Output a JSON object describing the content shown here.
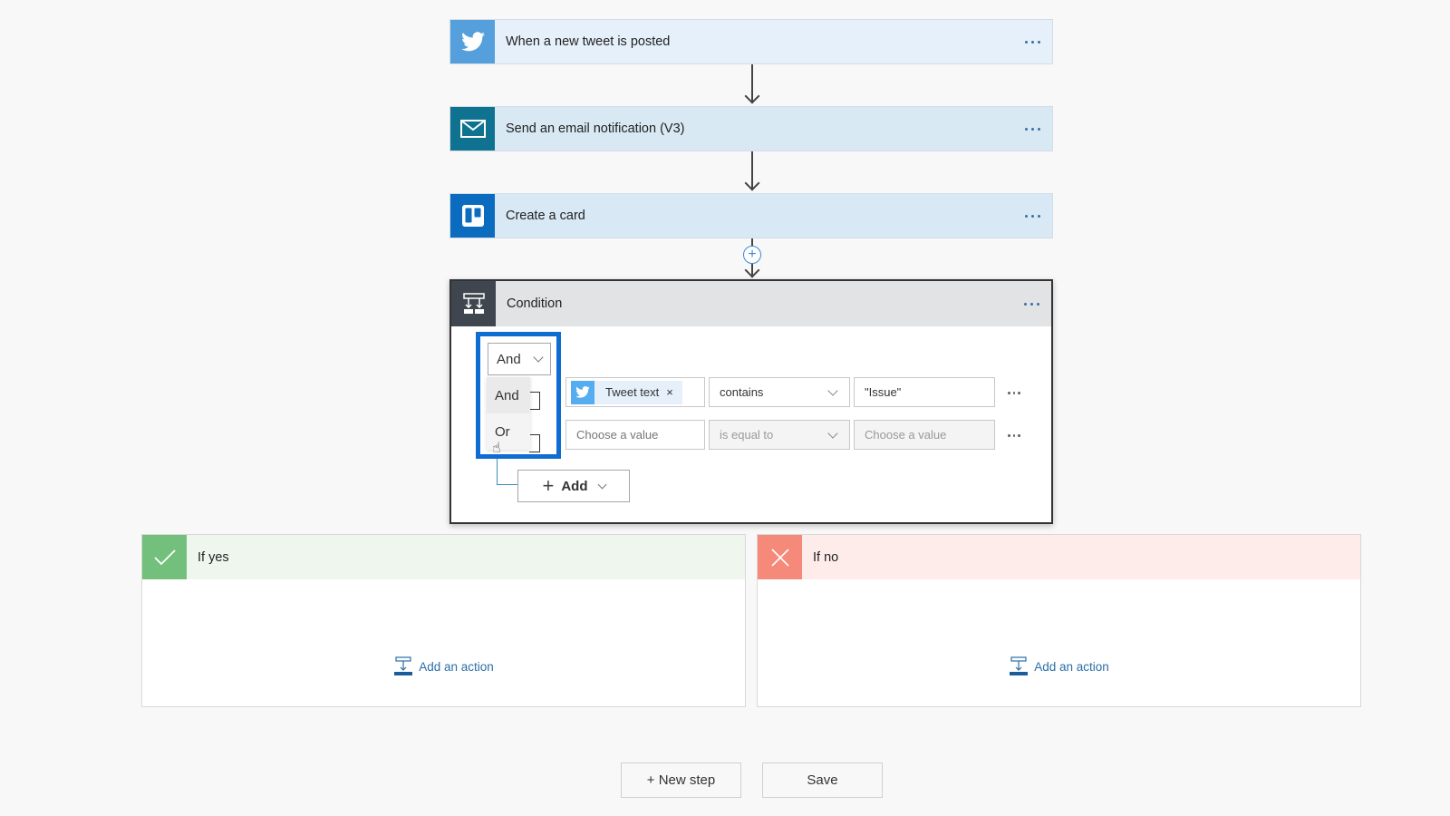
{
  "steps": [
    {
      "title": "When a new tweet is posted",
      "icon": "twitter-icon",
      "icon_bg": "#55a0dc",
      "bg": "#e6f0fa"
    },
    {
      "title": "Send an email notification (V3)",
      "icon": "mail-icon",
      "icon_bg": "#0e7290",
      "bg": "#d8e9f3"
    },
    {
      "title": "Create a card",
      "icon": "trello-icon",
      "icon_bg": "#0a6bbf",
      "bg": "#d8e8f5"
    }
  ],
  "more_label": "More options",
  "condition": {
    "title": "Condition",
    "group_operator": "And",
    "operator_options": [
      "And",
      "Or"
    ],
    "rows": [
      {
        "left_token": "Tweet text",
        "operator": "contains",
        "value": "\"Issue\""
      },
      {
        "left_placeholder": "Choose a value",
        "operator": "is equal to",
        "value_placeholder": "Choose a value"
      }
    ],
    "add_label": "Add"
  },
  "branches": {
    "yes": {
      "title": "If yes",
      "add_action": "Add an action"
    },
    "no": {
      "title": "If no",
      "add_action": "Add an action"
    }
  },
  "footer": {
    "new_step": "+ New step",
    "save": "Save"
  },
  "colors": {
    "accent": "#0f6cd1",
    "link": "#2b6ea8",
    "yes": "#72c07c",
    "no": "#f68a7a"
  }
}
